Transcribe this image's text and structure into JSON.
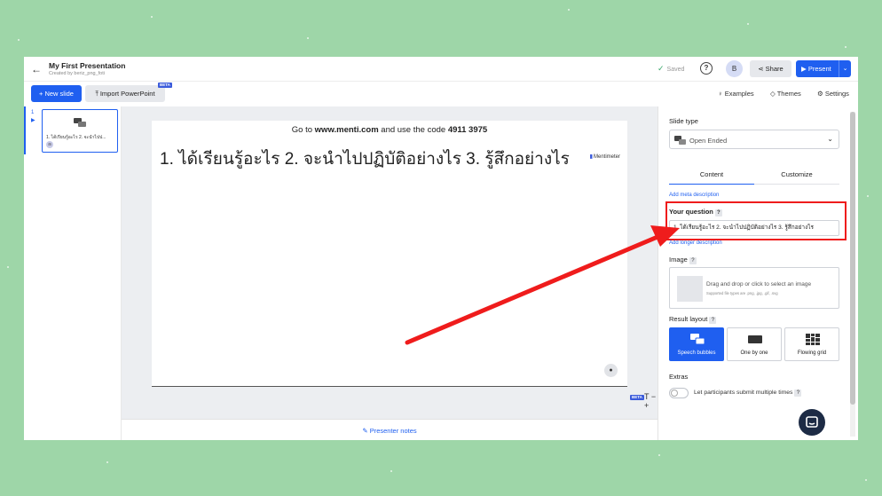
{
  "header": {
    "title": "My First Presentation",
    "subtitle": "Created by beriz_png_foti",
    "saved_label": "Saved",
    "help_icon": "question-circle-icon",
    "avatar_initial": "B",
    "share_label": "Share",
    "present_label": "Present"
  },
  "toolbar": {
    "new_slide_label": "New slide",
    "import_label": "Import PowerPoint",
    "beta_label": "BETA",
    "examples_label": "Examples",
    "themes_label": "Themes",
    "settings_label": "Settings"
  },
  "slides": [
    {
      "number": "1",
      "thumb_text": "1. ได้เรียนรู้อะไร 2. จะนำไปป..."
    }
  ],
  "slide": {
    "code_prefix": "Go to ",
    "url": "www.menti.com",
    "code_middle": " and use the code ",
    "code": "4911 3975",
    "question": "1. ได้เรียนรู้อะไร 2. จะนำไปปฏิบัติอย่างไร 3. รู้สึกอย่างไร",
    "brand": "Mentimeter"
  },
  "canvas": {
    "beta_label": "BETA",
    "text_controls": "T − +",
    "presenter_notes_label": "Presenter notes"
  },
  "panel": {
    "slide_type_label": "Slide type",
    "slide_type_value": "Open Ended",
    "tab_content": "Content",
    "tab_customize": "Customize",
    "add_meta": "Add meta description",
    "your_question_label": "Your question",
    "question_value": "1. ได้เรียนรู้อะไร 2. จะนำไปปฏิบัติอย่างไร 3. รู้สึกอย่างไร",
    "add_longer": "Add longer description",
    "image_label": "Image",
    "drop_text": "Drag and drop or click to select an image",
    "drop_sub": "Supported file types are .png, .jpg, .gif, .svg",
    "result_layout_label": "Result layout",
    "layouts": [
      {
        "label": "Speech bubbles"
      },
      {
        "label": "One by one"
      },
      {
        "label": "Flowing grid"
      }
    ],
    "extras_label": "Extras",
    "multiple_times_label": "Let participants submit multiple times",
    "help_mark": "?"
  },
  "colors": {
    "background": "#9ed6a8",
    "accent": "#1f5ff0",
    "highlight": "#ef1c1c",
    "chat": "#1d2b45"
  }
}
